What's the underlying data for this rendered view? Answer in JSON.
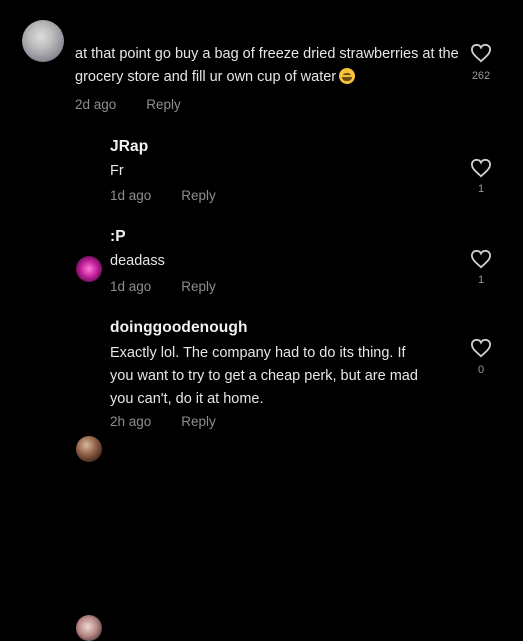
{
  "comments": [
    {
      "username": "",
      "text": "at that point go buy a bag of freeze dried strawberries at the grocery store and fill ur own cup of water",
      "emoji": "crying-face",
      "time": "2d ago",
      "reply": "Reply",
      "likes": "262"
    },
    {
      "username": "JRap",
      "text": "Fr",
      "time": "1d ago",
      "reply": "Reply",
      "likes": "1"
    },
    {
      "username": ":P",
      "text": "deadass",
      "time": "1d ago",
      "reply": "Reply",
      "likes": "1"
    },
    {
      "username": "doinggoodenough",
      "text_lines": [
        "Exactly lol. The company had to do its thing. If",
        "you want to try to get a cheap perk, but are mad",
        "you can't, do it at home."
      ],
      "time": "2h ago",
      "reply": "Reply",
      "likes": "0"
    }
  ],
  "colors": {
    "background": "#000000",
    "text": "#e6e6e6",
    "muted": "#8e8e8e"
  },
  "icons": [
    "heart-outline-icon"
  ]
}
